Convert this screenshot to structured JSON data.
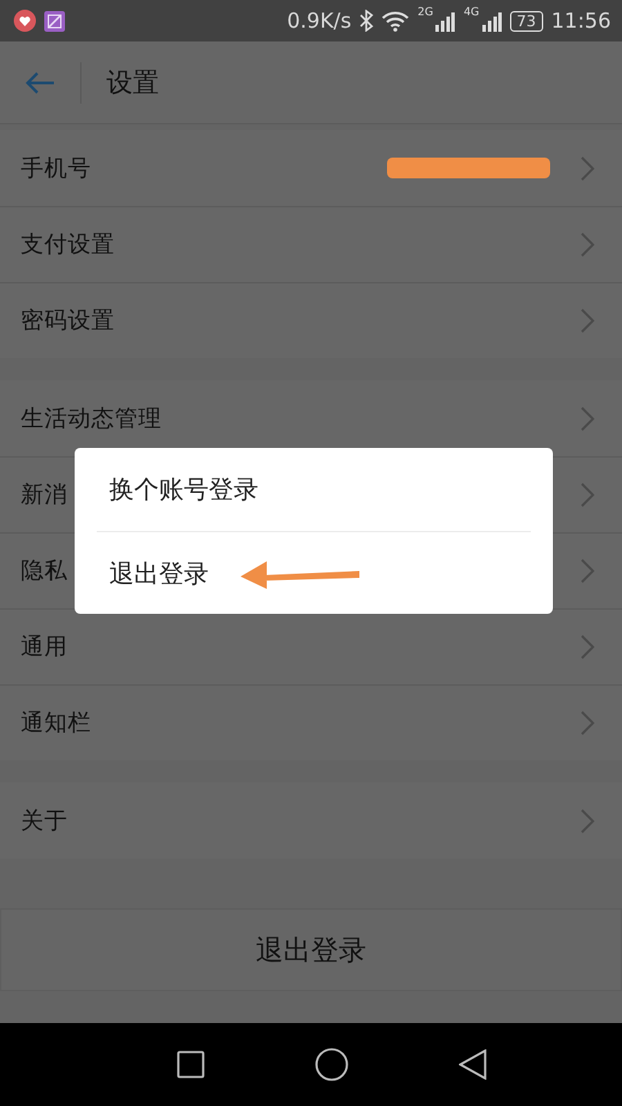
{
  "status_bar": {
    "net_speed": "0.9K/s",
    "signal_1": "2G",
    "signal_2": "4G",
    "battery": "73",
    "time": "11:56"
  },
  "header": {
    "title": "设置"
  },
  "groups": [
    {
      "rows": [
        {
          "label": "手机号",
          "value_redacted": true
        },
        {
          "label": "支付设置",
          "value_redacted": false
        },
        {
          "label": "密码设置",
          "value_redacted": false
        }
      ]
    },
    {
      "rows": [
        {
          "label": "生活动态管理",
          "value_redacted": false
        },
        {
          "label": "新消",
          "value_redacted": false
        },
        {
          "label": "隐私",
          "value_redacted": false
        },
        {
          "label": "通用",
          "value_redacted": false
        },
        {
          "label": "通知栏",
          "value_redacted": false
        }
      ]
    },
    {
      "rows": [
        {
          "label": "关于",
          "value_redacted": false
        }
      ]
    }
  ],
  "logout_button": "退出登录",
  "dialog": {
    "options": [
      {
        "label": "换个账号登录",
        "pointed_at": false
      },
      {
        "label": "退出登录",
        "pointed_at": true
      }
    ]
  }
}
